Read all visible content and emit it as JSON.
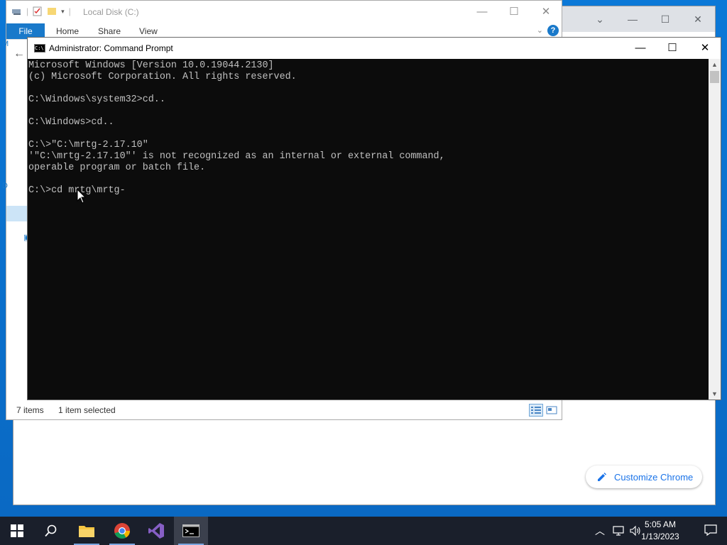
{
  "chrome_window": {
    "customize_label": "Customize Chrome"
  },
  "explorer": {
    "title": "Local Disk (C:)",
    "ribbon": {
      "file": "File",
      "home": "Home",
      "share": "Share",
      "view": "View"
    },
    "status": {
      "items": "7 items",
      "selected": "1 item selected"
    }
  },
  "cmd": {
    "title": "Administrator: Command Prompt",
    "lines": [
      "Microsoft Windows [Version 10.0.19044.2130]",
      "(c) Microsoft Corporation. All rights reserved.",
      "",
      "C:\\Windows\\system32>cd..",
      "",
      "C:\\Windows>cd..",
      "",
      "C:\\>\"C:\\mrtg-2.17.10\"",
      "'\"C:\\mrtg-2.17.10\"' is not recognized as an internal or external command,",
      "operable program or batch file.",
      "",
      "C:\\>cd mrtg\\mrtg-"
    ]
  },
  "taskbar": {
    "time": "5:05 AM",
    "date": "1/13/2023"
  },
  "colors": {
    "desktop": "#0a6fd0",
    "taskbar": "#1a1f2b",
    "cmd_bg": "#0c0c0c",
    "cmd_text": "#c0c0c0",
    "accent": "#1979ca"
  }
}
